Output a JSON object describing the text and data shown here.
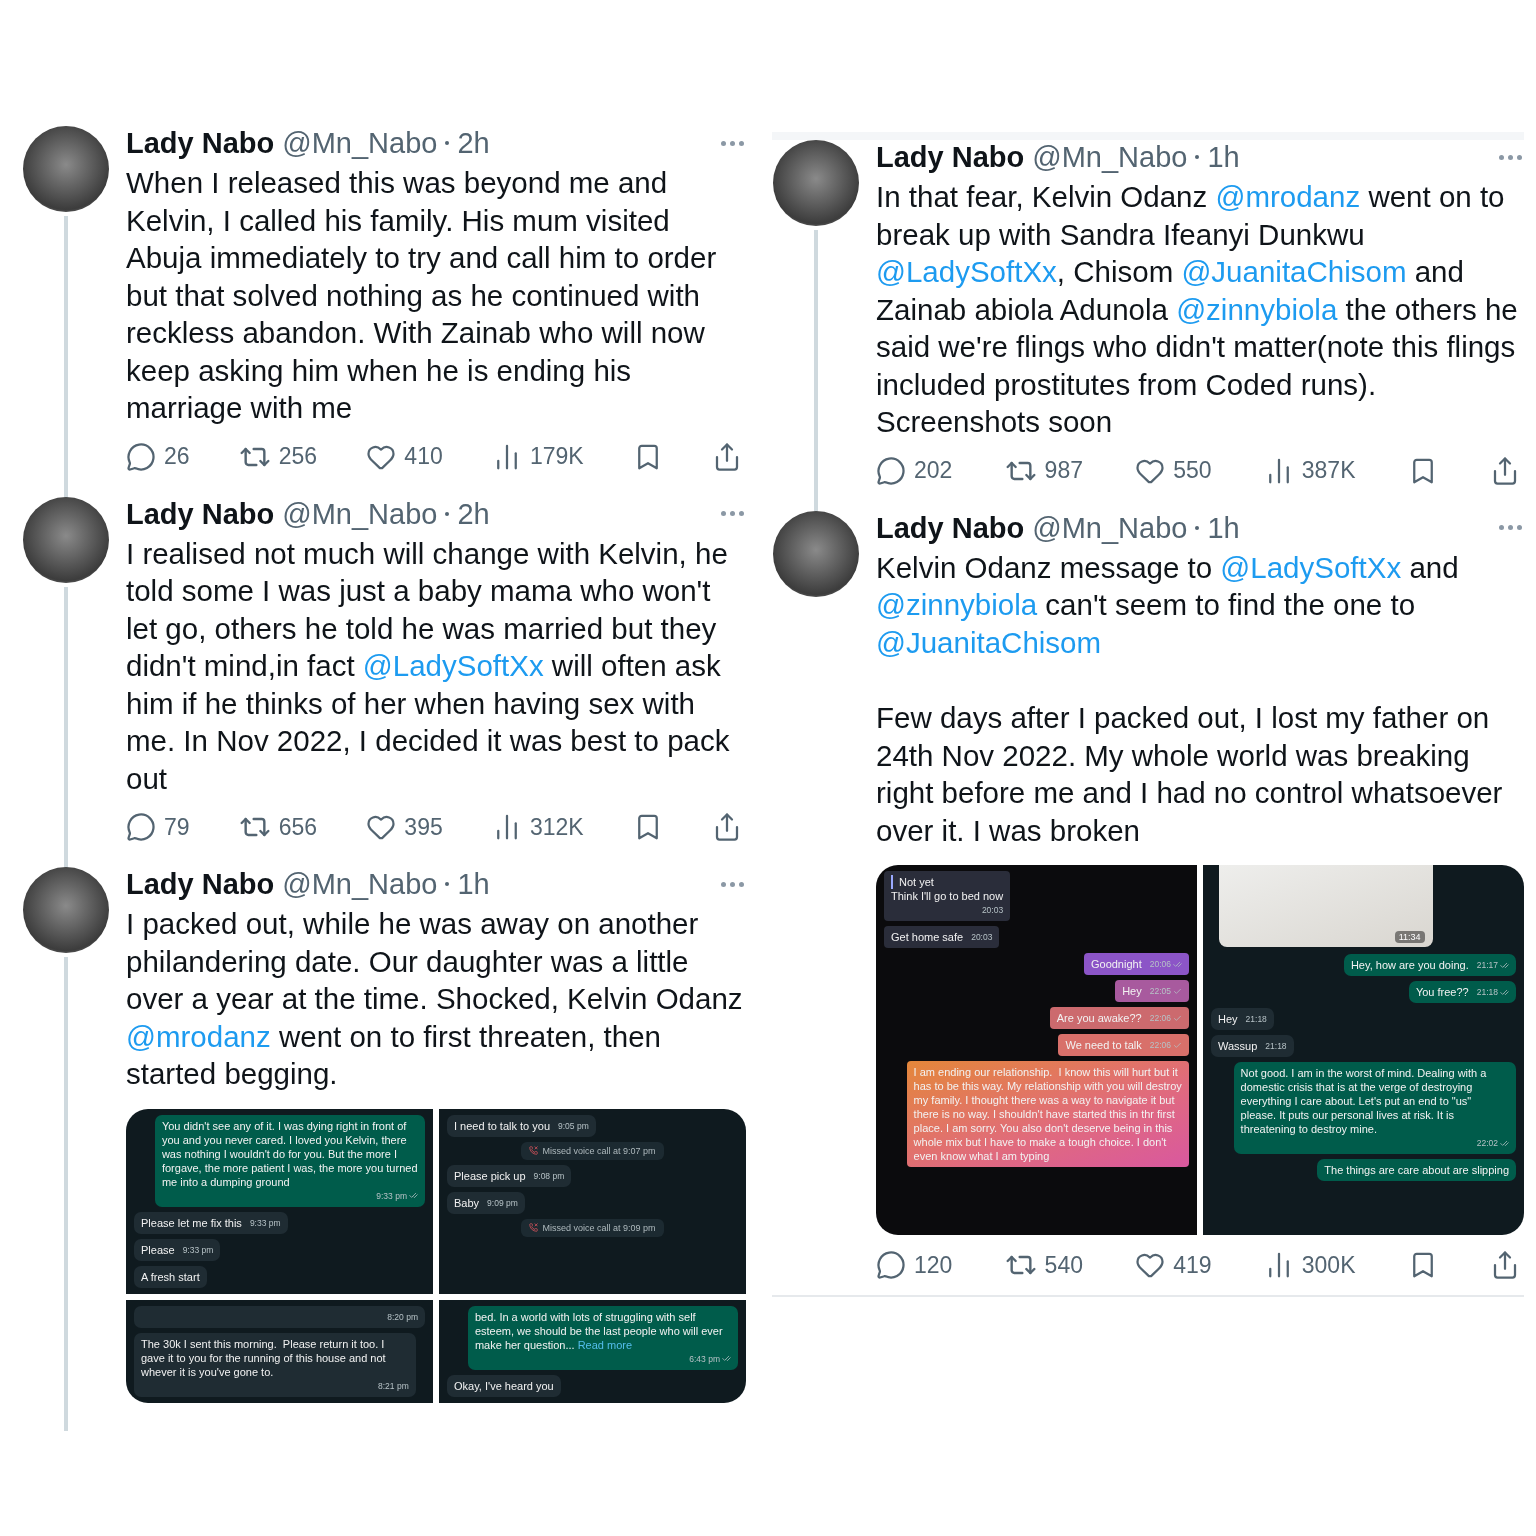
{
  "columns": [
    {
      "tweets": [
        {
          "name": "Lady Nabo",
          "handle": "@Mn_Nabo",
          "time": "2h",
          "thread_line": true,
          "paragraphs": [
            [
              {
                "kind": "text",
                "text": "When I released this was beyond me and Kelvin, I called his family. His mum visited Abuja immediately to try and call him to order but that solved nothing as he continued with reckless abandon. With Zainab who will now keep asking him when he is ending his marriage with me"
              }
            ]
          ],
          "stats": {
            "replies": "26",
            "reposts": "256",
            "likes": "410",
            "views": "179K"
          }
        },
        {
          "name": "Lady Nabo",
          "handle": "@Mn_Nabo",
          "time": "2h",
          "thread_line": true,
          "paragraphs": [
            [
              {
                "kind": "text",
                "text": "I realised not much will change with Kelvin, he told some I was just a baby mama who won't let go, others he told he was married but they didn't mind,in fact "
              },
              {
                "kind": "mention",
                "text": "@LadySoftXx"
              },
              {
                "kind": "text",
                "text": " will often ask him if he thinks of her when having sex with me. In Nov 2022, I decided it was best to pack out"
              }
            ]
          ],
          "stats": {
            "replies": "79",
            "reposts": "656",
            "likes": "395",
            "views": "312K"
          }
        },
        {
          "name": "Lady Nabo",
          "handle": "@Mn_Nabo",
          "time": "1h",
          "thread_line": true,
          "paragraphs": [
            [
              {
                "kind": "text",
                "text": "I packed out, while he was away on another philandering date. Our daughter was a little over a year at the time. Shocked, Kelvin Odanz "
              },
              {
                "kind": "mention",
                "text": "@mrodanz"
              },
              {
                "kind": "text",
                "text": " went on to first threaten, then started begging."
              }
            ]
          ],
          "media": {
            "panels": [
              {
                "kind": "whatsapp",
                "messages": [
                  {
                    "kind": "bubble",
                    "outgoing": true,
                    "text": "You didn't see any of it. I was dying right in front of you and you never cared. I loved you Kelvin, there was nothing I wouldn't do for you. But the more I forgave, the more patient I was, the more you turned me into a dumping ground",
                    "time": "9:33 pm",
                    "read": true
                  },
                  {
                    "kind": "bubble",
                    "outgoing": false,
                    "text": "Please let me fix this",
                    "time": "9:33 pm"
                  },
                  {
                    "kind": "bubble",
                    "outgoing": false,
                    "text": "Please",
                    "time": "9:33 pm"
                  },
                  {
                    "kind": "bubble",
                    "outgoing": false,
                    "text": "A fresh start"
                  }
                ]
              },
              {
                "kind": "whatsapp",
                "messages": [
                  {
                    "kind": "bubble",
                    "outgoing": false,
                    "text": "I need to talk to you",
                    "time": "9:05 pm"
                  },
                  {
                    "kind": "call",
                    "text": "Missed voice call at 9:07 pm"
                  },
                  {
                    "kind": "bubble",
                    "outgoing": false,
                    "text": "Please pick up",
                    "time": "9:08 pm"
                  },
                  {
                    "kind": "bubble",
                    "outgoing": false,
                    "text": "Baby",
                    "time": "9:09 pm"
                  },
                  {
                    "kind": "call",
                    "text": "Missed voice call at 9:09 pm"
                  }
                ]
              },
              {
                "kind": "whatsapp",
                "messages": [
                  {
                    "kind": "stub",
                    "time": "8:20 pm"
                  },
                  {
                    "kind": "bubble",
                    "outgoing": false,
                    "text": "The 30k I sent this morning.  Please return it too. I gave it to you for the running of this house and not whever it is you've gone to.",
                    "time": "8:21 pm"
                  }
                ]
              },
              {
                "kind": "whatsapp",
                "messages": [
                  {
                    "kind": "bubble",
                    "outgoing": true,
                    "text": "bed. In a world with lots of struggling with self esteem, we should be the last people who will ever make her question...",
                    "link": "Read more",
                    "time": "6:43 pm",
                    "read": true
                  },
                  {
                    "kind": "bubble",
                    "outgoing": false,
                    "text": "Okay, I've heard you"
                  }
                ]
              }
            ]
          }
        }
      ]
    },
    {
      "tweets": [
        {
          "name": "Lady Nabo",
          "handle": "@Mn_Nabo",
          "time": "1h",
          "thread_line": true,
          "paragraphs": [
            [
              {
                "kind": "text",
                "text": "In that fear, Kelvin Odanz "
              },
              {
                "kind": "mention",
                "text": "@mrodanz"
              },
              {
                "kind": "text",
                "text": " went on to break up with Sandra Ifeanyi Dunkwu "
              },
              {
                "kind": "mention",
                "text": "@LadySoftXx"
              },
              {
                "kind": "text",
                "text": ", Chisom "
              },
              {
                "kind": "mention",
                "text": "@JuanitaChisom"
              },
              {
                "kind": "text",
                "text": " and Zainab abiola Adunola "
              },
              {
                "kind": "mention",
                "text": "@zinnybiola"
              },
              {
                "kind": "text",
                "text": " the others he said we're flings who didn't matter(note this flings included prostitutes from Coded runs). Screenshots soon"
              }
            ]
          ],
          "stats": {
            "replies": "202",
            "reposts": "987",
            "likes": "550",
            "views": "387K"
          }
        },
        {
          "name": "Lady Nabo",
          "handle": "@Mn_Nabo",
          "time": "1h",
          "thread_line": false,
          "paragraphs": [
            [
              {
                "kind": "text",
                "text": "Kelvin Odanz message to "
              },
              {
                "kind": "mention",
                "text": "@LadySoftXx"
              },
              {
                "kind": "text",
                "text": " and "
              },
              {
                "kind": "mention",
                "text": "@zinnybiola"
              },
              {
                "kind": "text",
                "text": " can't seem to find the one to "
              },
              {
                "kind": "mention",
                "text": "@JuanitaChisom"
              }
            ],
            [
              {
                "kind": "text",
                "text": "Few days after I packed out, I lost my father on 24th Nov 2022. My whole world was breaking right before me and I had no control whatsoever over it. I was broken"
              }
            ]
          ],
          "media": {
            "panels": [
              {
                "kind": "telegram",
                "messages": [
                  {
                    "kind": "bubble",
                    "outgoing": false,
                    "quote": "Not yet",
                    "text": "Think I'll go to bed now",
                    "time": "20:03"
                  },
                  {
                    "kind": "bubble",
                    "outgoing": false,
                    "text": "Get home safe",
                    "time": "20:03"
                  },
                  {
                    "kind": "bubble",
                    "outgoing": true,
                    "text": "Goodnight",
                    "time": "20:06",
                    "read": true
                  },
                  {
                    "kind": "bubble",
                    "outgoing": true,
                    "text": "Hey",
                    "time": "22:05",
                    "read": false
                  },
                  {
                    "kind": "bubble",
                    "outgoing": true,
                    "text": "Are you awake??",
                    "time": "22:06",
                    "read": false
                  },
                  {
                    "kind": "bubble",
                    "outgoing": true,
                    "text": "We need to talk",
                    "time": "22:06",
                    "read": false
                  },
                  {
                    "kind": "bubble",
                    "outgoing": true,
                    "text": "I am ending our relationship.  I know this will hurt but it has to be this way. My relationship with you will destroy my family. I thought there was a way to navigate it but there is no way. I shouldn't have started this in thr first place. I am sorry. You also don't deserve being in this whole mix but I have to make a tough choice. I don't even know what I am typing"
                  }
                ]
              },
              {
                "kind": "whatsapp",
                "messages": [
                  {
                    "kind": "photo",
                    "time": "11:34"
                  },
                  {
                    "kind": "bubble",
                    "outgoing": true,
                    "text": "Hey, how are you doing.",
                    "time": "21:17",
                    "read": true
                  },
                  {
                    "kind": "bubble",
                    "outgoing": true,
                    "text": "You free??",
                    "time": "21:18",
                    "read": true
                  },
                  {
                    "kind": "bubble",
                    "outgoing": false,
                    "text": "Hey",
                    "time": "21:18"
                  },
                  {
                    "kind": "bubble",
                    "outgoing": false,
                    "text": "Wassup",
                    "time": "21:18"
                  },
                  {
                    "kind": "bubble",
                    "outgoing": true,
                    "text": "Not good. I am in the worst of mind. Dealing with a domestic crisis that is at the verge of destroying everything I care about. Let's put an end to \"us\" please. It puts our personal lives at risk. It is threatening to destroy mine.",
                    "time": "22:02",
                    "read": true
                  },
                  {
                    "kind": "bubble",
                    "outgoing": true,
                    "text": "The things are care about are slipping"
                  }
                ]
              }
            ]
          },
          "stats": {
            "replies": "120",
            "reposts": "540",
            "likes": "419",
            "views": "300K"
          }
        }
      ]
    }
  ]
}
